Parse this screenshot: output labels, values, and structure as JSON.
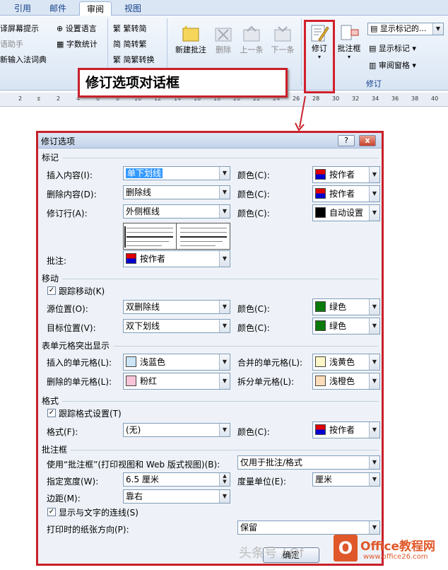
{
  "ribbon": {
    "tabs": [
      "引用",
      "邮件",
      "审阅",
      "视图"
    ],
    "active_tab": "审阅",
    "left_items": [
      "译屏幕提示",
      "语助手",
      "新输入法词典"
    ],
    "set_language": "设置语言",
    "word_count": "字数统计",
    "trad_simp": [
      "繁转简",
      "简转繁",
      "简繁转换"
    ],
    "comments": {
      "new": "新建批注",
      "delete": "删除",
      "prev": "上一条",
      "next": "下一条"
    },
    "track_changes": "修订",
    "balloons": "批注框",
    "show_markup_select": "显示标记的...",
    "show_markup": "显示标记",
    "reviewing_pane": "审阅窗格",
    "group_label": "修订",
    "ruler_numbers": [
      "2",
      "2",
      "4",
      "6",
      "8",
      "10",
      "12",
      "14",
      "16",
      "18",
      "20",
      "22",
      "24",
      "26",
      "28",
      "30",
      "32",
      "34",
      "36",
      "38",
      "40"
    ]
  },
  "callout": "修订选项对话框",
  "dialog": {
    "title": "修订选项",
    "help": "?",
    "close": "x",
    "markup": {
      "heading": "标记",
      "insertions": {
        "label": "插入内容(I):",
        "value": "单下划线",
        "color_label": "颜色(C):",
        "color": "按作者"
      },
      "deletions": {
        "label": "删除内容(D):",
        "value": "删除线",
        "color_label": "颜色(C):",
        "color": "按作者"
      },
      "changed_lines": {
        "label": "修订行(A):",
        "value": "外侧框线",
        "color_label": "颜色(C):",
        "color": "自动设置"
      },
      "comments": {
        "label": "批注:",
        "value": "按作者"
      }
    },
    "moves": {
      "heading": "移动",
      "track": "跟踪移动(K)",
      "from": {
        "label": "源位置(O):",
        "value": "双删除线",
        "color_label": "颜色(C):",
        "color": "绿色"
      },
      "to": {
        "label": "目标位置(V):",
        "value": "双下划线",
        "color_label": "颜色(C):",
        "color": "绿色"
      }
    },
    "table": {
      "heading": "表单元格突出显示",
      "inserted": {
        "label": "插入的单元格(L):",
        "value": "浅蓝色"
      },
      "merged": {
        "label": "合并的单元格(L):",
        "value": "浅黄色"
      },
      "deleted": {
        "label": "删除的单元格(L):",
        "value": "粉红"
      },
      "split": {
        "label": "拆分单元格(L):",
        "value": "浅橙色"
      }
    },
    "formatting": {
      "heading": "格式",
      "track": "跟踪格式设置(T)",
      "format": {
        "label": "格式(F):",
        "value": "(无)",
        "color_label": "颜色(C):",
        "color": "按作者"
      }
    },
    "balloons": {
      "heading": "批注框",
      "use": {
        "label": "使用“批注框”(打印视图和 Web 版式视图)(B):",
        "value": "仅用于批注/格式"
      },
      "width": {
        "label": "指定宽度(W):",
        "value": "6.5 厘米"
      },
      "measure": {
        "label": "度量单位(E):",
        "value": "厘米"
      },
      "margin": {
        "label": "边距(M):",
        "value": "靠右"
      },
      "show_lines": "显示与文字的连线(S)",
      "paper": {
        "label": "打印时的纸张方向(P):",
        "value": "保留"
      }
    },
    "ok": "确定"
  },
  "watermark": "头条号 / Of",
  "logo": {
    "letter": "O",
    "title": "Office教程网",
    "url": "www.office26.com"
  },
  "colors": {
    "author_red": "#e00000",
    "author_blue": "#0000d0",
    "auto": "#000000",
    "green": "#0a7a0a",
    "light_blue": "#cce6f8",
    "light_yellow": "#fdf6c6",
    "pink": "#f8c4d8",
    "light_orange": "#fbdcb8",
    "highlight": "#d21f2b"
  }
}
